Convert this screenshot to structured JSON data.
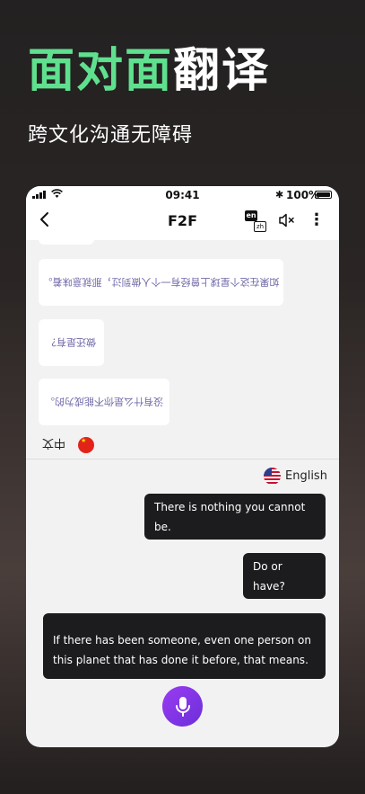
{
  "headline": {
    "accent": "面对面",
    "plain": "翻译"
  },
  "subheadline": "跨文化沟通无障碍",
  "status_bar": {
    "time": "09:41",
    "battery": "100%"
  },
  "nav": {
    "title": "F2F",
    "lang_toggle": {
      "from": "en",
      "to": "zh"
    }
  },
  "partner": {
    "messages": [
      "如果在这个星球上曾经有一个人做到过，那就意味着。",
      "做还是有？",
      "没有什么是你不能成为的。"
    ],
    "language": "中文"
  },
  "self": {
    "language": "English",
    "messages": [
      "There is nothing you cannot be.",
      "Do or have?",
      "If there has been someone, even one person on this planet that has done it before, that means."
    ]
  },
  "colors": {
    "accent_green": "#5fe08f",
    "mic_purple": "#7b2ff0",
    "bubble_dark": "#1c1c1e",
    "partner_text": "#6f6aa8"
  }
}
